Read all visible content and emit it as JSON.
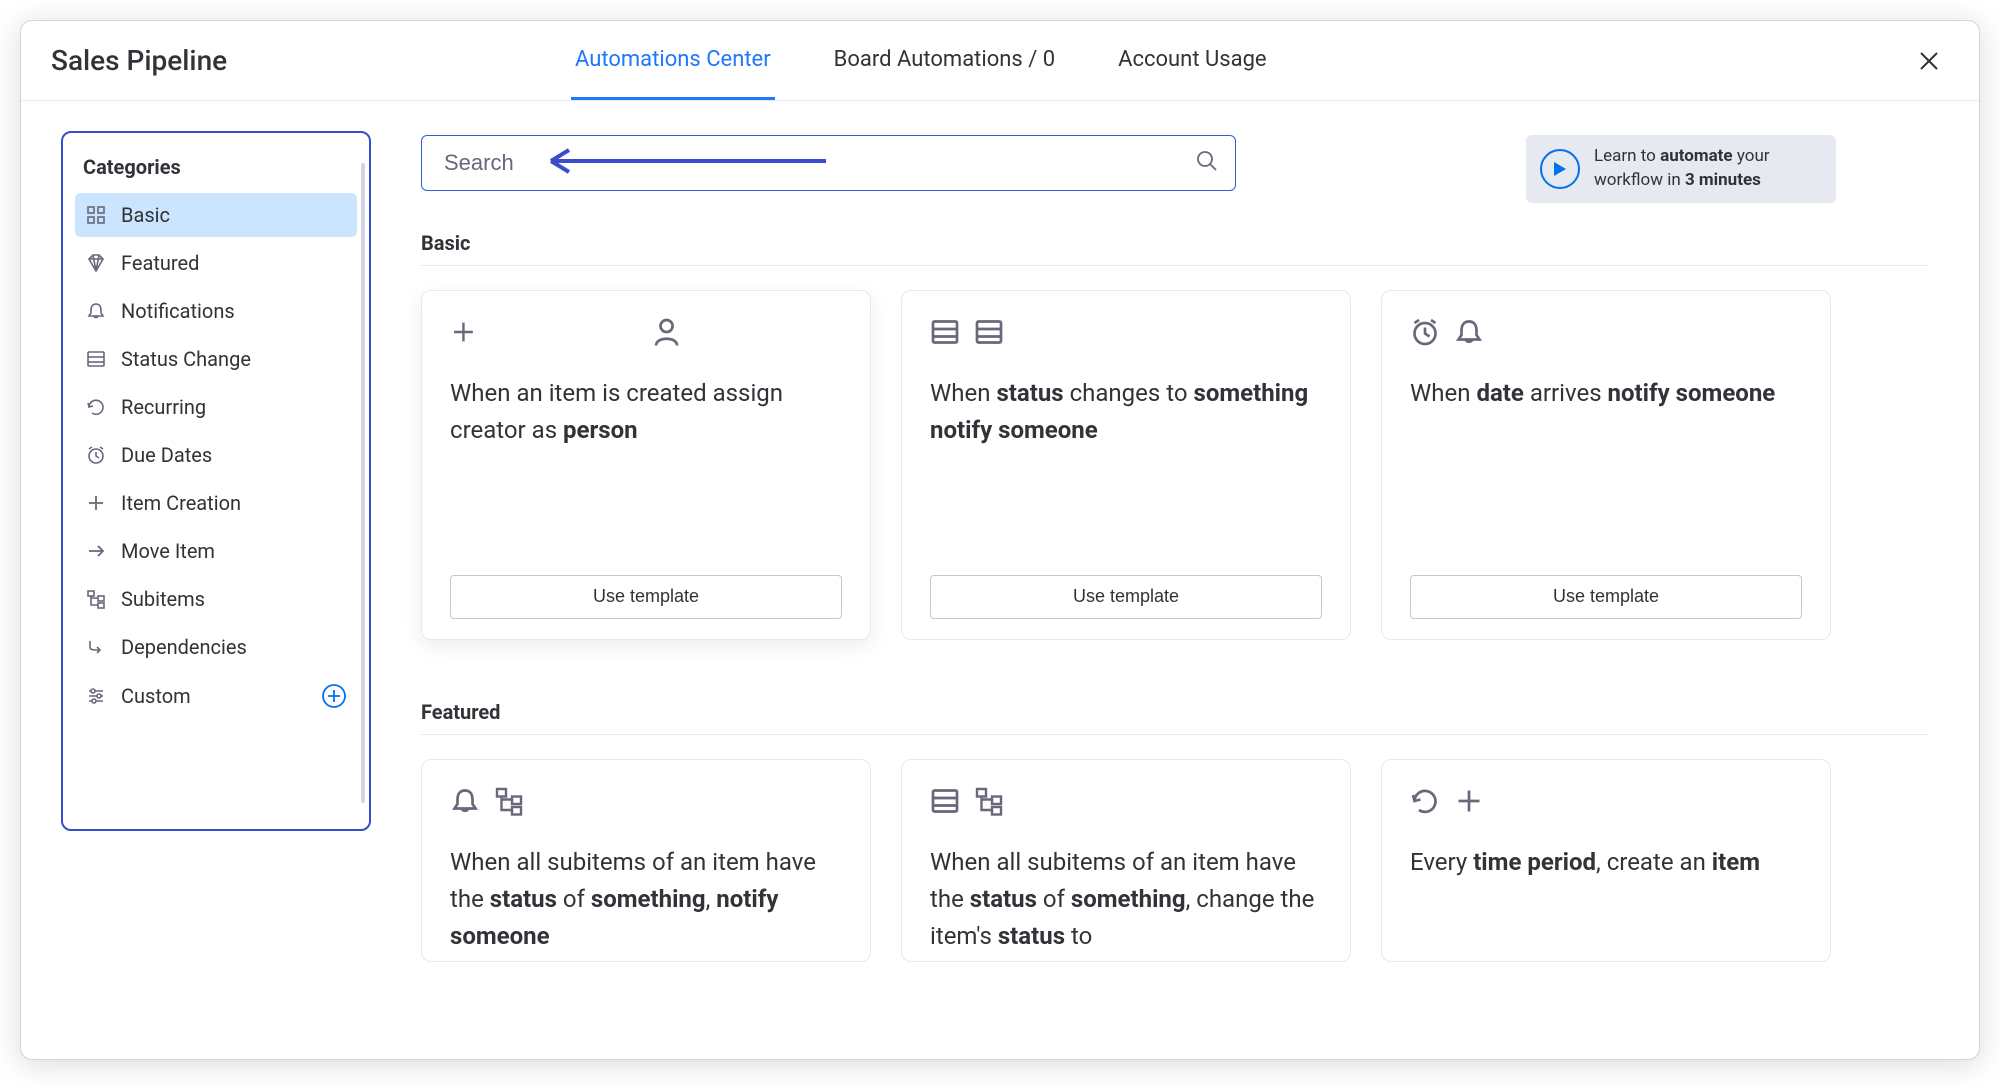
{
  "header": {
    "title": "Sales Pipeline",
    "tabs": [
      {
        "label": "Automations Center",
        "active": true
      },
      {
        "label": "Board Automations / 0",
        "active": false
      },
      {
        "label": "Account Usage",
        "active": false
      }
    ]
  },
  "sidebar": {
    "title": "Categories",
    "items": [
      {
        "label": "Basic",
        "icon": "grid",
        "active": true
      },
      {
        "label": "Featured",
        "icon": "diamond",
        "active": false
      },
      {
        "label": "Notifications",
        "icon": "bell",
        "active": false
      },
      {
        "label": "Status Change",
        "icon": "list",
        "active": false
      },
      {
        "label": "Recurring",
        "icon": "recur",
        "active": false
      },
      {
        "label": "Due Dates",
        "icon": "alarm",
        "active": false
      },
      {
        "label": "Item Creation",
        "icon": "plus",
        "active": false
      },
      {
        "label": "Move Item",
        "icon": "arrow",
        "active": false
      },
      {
        "label": "Subitems",
        "icon": "tree",
        "active": false
      },
      {
        "label": "Dependencies",
        "icon": "dep",
        "active": false
      },
      {
        "label": "Custom",
        "icon": "sliders",
        "active": false,
        "add": true
      }
    ]
  },
  "search": {
    "placeholder": "Search"
  },
  "promo": {
    "line1_a": "Learn to ",
    "line1_b": "automate",
    "line1_c": " your",
    "line2_a": "workflow in ",
    "line2_b": "3 minutes"
  },
  "sections": {
    "basic": {
      "title": "Basic",
      "cards": [
        {
          "icons": [
            "plus",
            "person"
          ],
          "parts": [
            "When an item is created assign creator as ",
            "person"
          ],
          "btn": "Use template"
        },
        {
          "icons": [
            "list",
            "list"
          ],
          "parts": [
            "When ",
            "status",
            " changes to ",
            "something",
            " ",
            "notify",
            " ",
            "someone"
          ],
          "btn": "Use template"
        },
        {
          "icons": [
            "alarm",
            "bell"
          ],
          "parts": [
            "When ",
            "date",
            " arrives ",
            "notify",
            " ",
            "someone"
          ],
          "btn": "Use template"
        }
      ]
    },
    "featured": {
      "title": "Featured",
      "cards": [
        {
          "icons": [
            "bell",
            "tree"
          ],
          "parts": [
            "When all subitems of an item have the ",
            "status",
            " of ",
            "something",
            ", ",
            "notify someone"
          ]
        },
        {
          "icons": [
            "list",
            "tree"
          ],
          "parts": [
            "When all subitems of an item have the ",
            "status",
            " of ",
            "something",
            ", change the item's ",
            "status",
            " to"
          ]
        },
        {
          "icons": [
            "recur",
            "plus"
          ],
          "parts": [
            "Every ",
            "time period",
            ", create an ",
            "item"
          ]
        }
      ]
    }
  }
}
